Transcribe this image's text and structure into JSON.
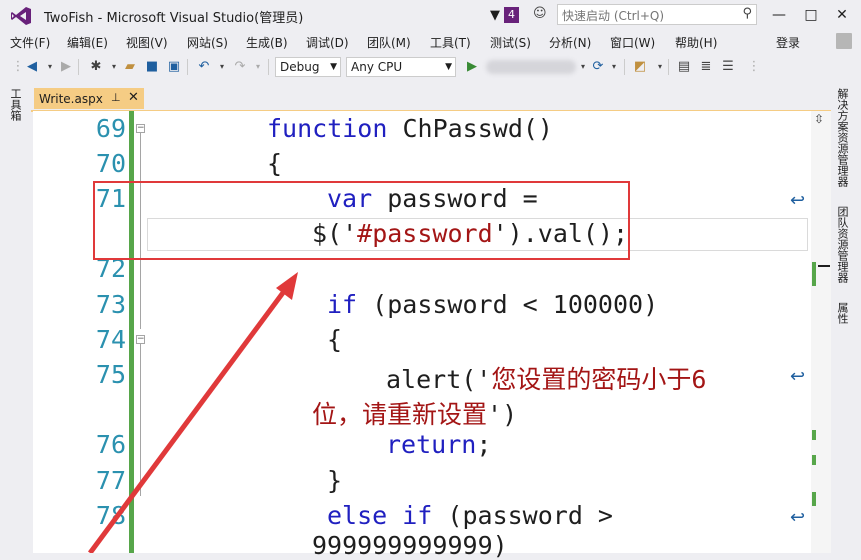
{
  "window": {
    "title": "TwoFish - Microsoft Visual Studio(管理员)",
    "notification_count": "4",
    "quick_launch_placeholder": "快速启动 (Ctrl+Q)",
    "minimize": "—",
    "maximize": "□",
    "close": "✕"
  },
  "menu": {
    "items": [
      "文件(F)",
      "编辑(E)",
      "视图(V)",
      "网站(S)",
      "生成(B)",
      "调试(D)",
      "团队(M)",
      "工具(T)",
      "测试(S)",
      "分析(N)",
      "窗口(W)",
      "帮助(H)"
    ],
    "login": "登录"
  },
  "toolbar": {
    "config": "Debug",
    "platform": "Any CPU"
  },
  "side": {
    "left_tab": "工具箱",
    "right_tabs": [
      "解决方案资源管理器",
      "团队资源管理器",
      "属性"
    ]
  },
  "tab": {
    "label": "Write.aspx",
    "pin": "⊥",
    "close": "✕"
  },
  "code": {
    "line_numbers": [
      "69",
      "70",
      "71",
      "72",
      "73",
      "74",
      "75",
      "76",
      "77",
      "78"
    ],
    "line69_kw": "function",
    "line69_rest": " ChPasswd()",
    "line70": "{",
    "line71_kw": "var",
    "line71_rest": " password =",
    "line71b_pre": "$('",
    "line71b_str": "#password",
    "line71b_post": "').val();",
    "line73_kw": "if",
    "line73_rest": " (password < 100000)",
    "line74": "{",
    "line75_pre": "alert('",
    "line75_str": "您设置的密码小于6",
    "line75b_str": "位，请重新设置",
    "line75b_post": "')",
    "line76_kw": "return",
    "line76_rest": ";",
    "line77": "}",
    "line78_kw": "else if",
    "line78_rest": " (password >",
    "line78b": "999999999999)"
  },
  "colors": {
    "keyword": "#2020c0",
    "string": "#a31515",
    "line_number": "#2b91af",
    "annotation": "#e0393a",
    "accent": "#68217a"
  }
}
